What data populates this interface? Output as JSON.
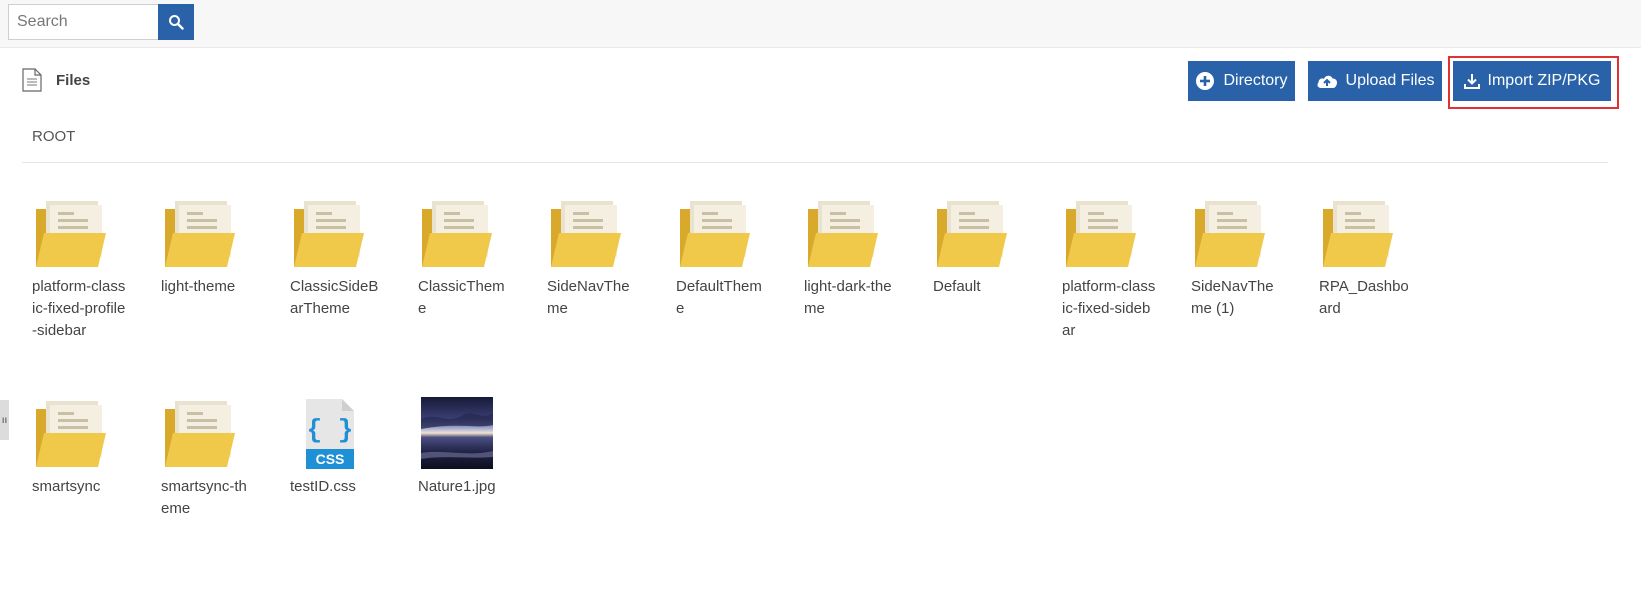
{
  "search": {
    "placeholder": "Search"
  },
  "header": {
    "title": "Files"
  },
  "actions": {
    "directory": "Directory",
    "upload": "Upload Files",
    "import": "Import ZIP/PKG"
  },
  "breadcrumb": "ROOT",
  "items": [
    {
      "name": "platform-class ic-fixed-profile -sidebar",
      "type": "folder"
    },
    {
      "name": "light-theme",
      "type": "folder"
    },
    {
      "name": "ClassicSideB arTheme",
      "type": "folder"
    },
    {
      "name": "ClassicThem e",
      "type": "folder"
    },
    {
      "name": "SideNavThe me",
      "type": "folder"
    },
    {
      "name": "DefaultThem e",
      "type": "folder"
    },
    {
      "name": "light-dark-the me",
      "type": "folder"
    },
    {
      "name": "Default",
      "type": "folder"
    },
    {
      "name": "platform-class ic-fixed-sideb ar",
      "type": "folder"
    },
    {
      "name": "SideNavThe me (1)",
      "type": "folder"
    },
    {
      "name": "RPA_Dashbo ard",
      "type": "folder"
    },
    {
      "name": "smartsync",
      "type": "folder"
    },
    {
      "name": "smartsync-th eme",
      "type": "folder"
    },
    {
      "name": "testID.css",
      "type": "css-file"
    },
    {
      "name": "Nature1.jpg",
      "type": "image-file"
    }
  ],
  "icons": {
    "search": "search-icon",
    "files": "document-icon",
    "directory": "plus-circle-icon",
    "upload": "cloud-upload-icon",
    "import": "download-icon",
    "folder": "folder-icon",
    "css": "css-file-icon",
    "image": "image-thumbnail"
  },
  "colors": {
    "accent": "#2962a8",
    "highlight": "#e03232",
    "folder": "#f0c94a"
  }
}
